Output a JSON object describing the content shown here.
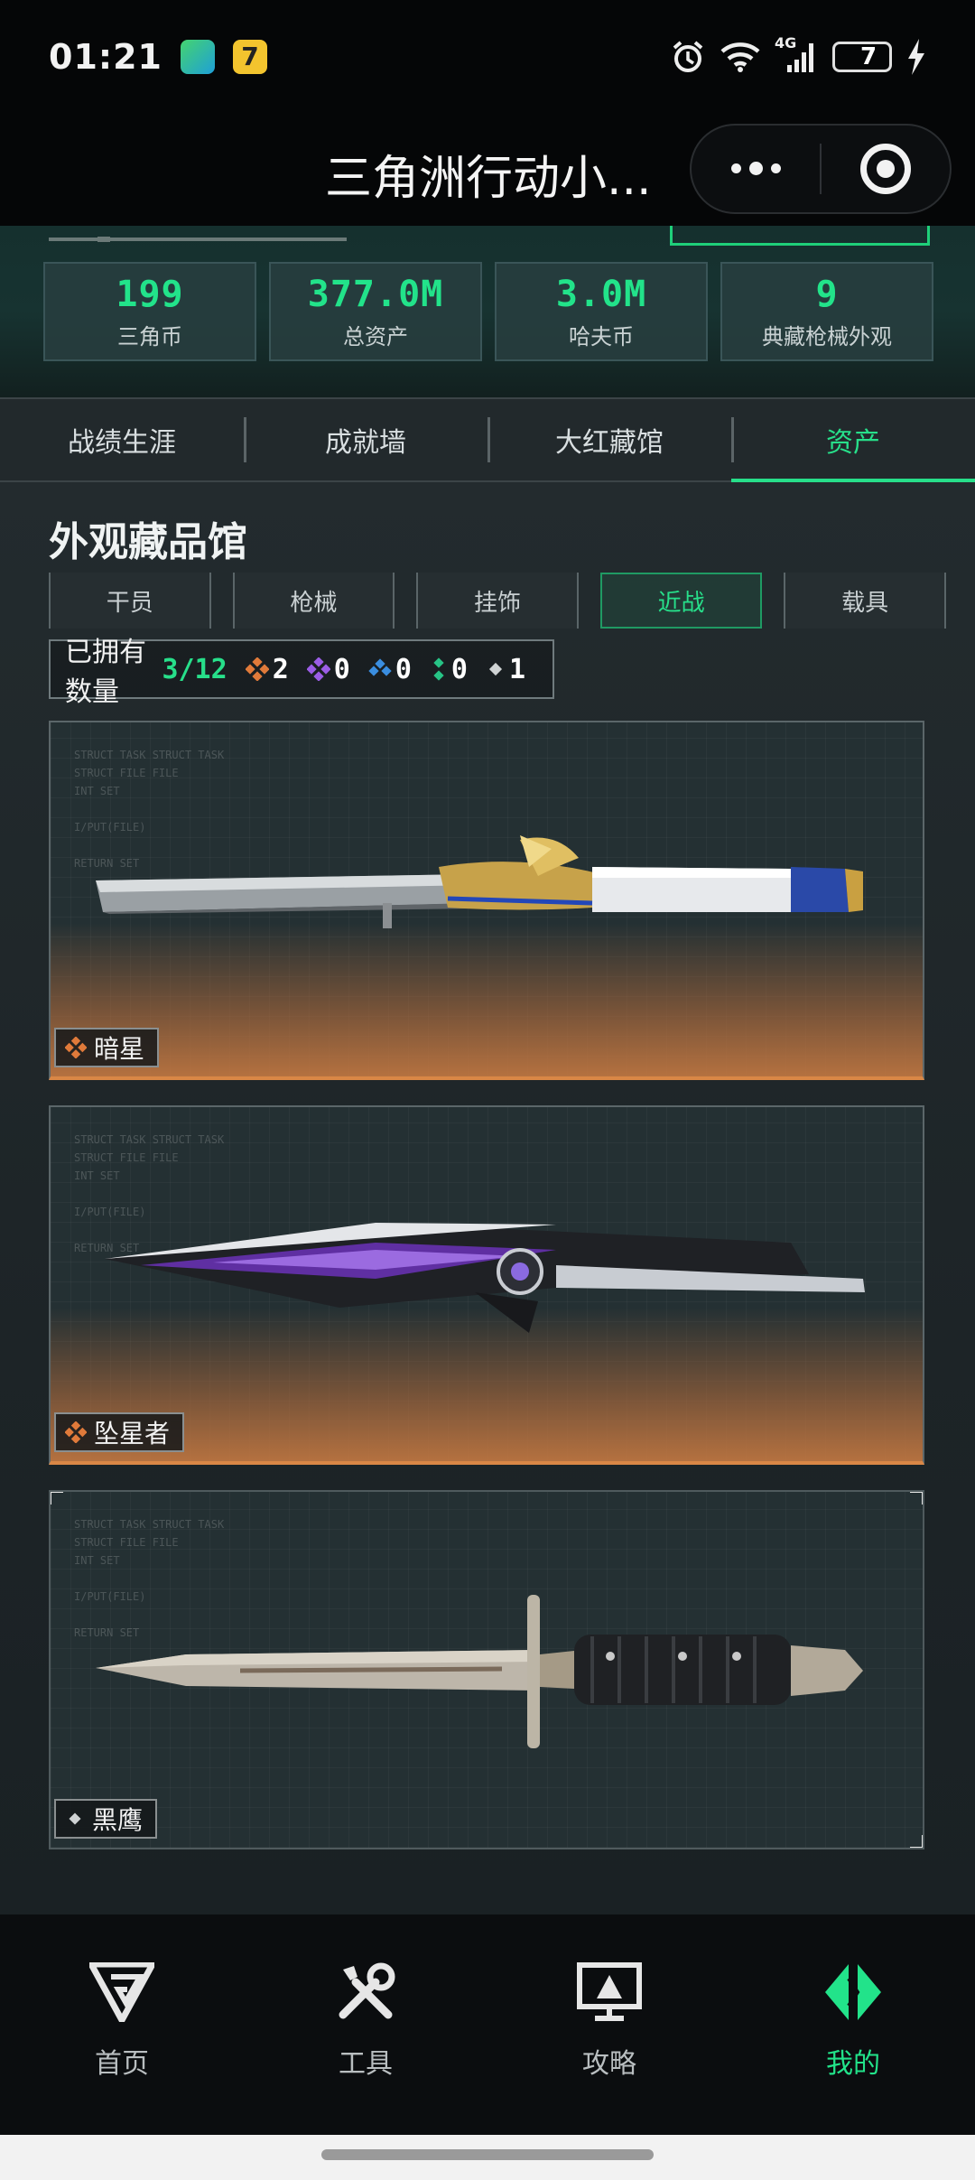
{
  "status_bar": {
    "time": "01:21",
    "app_icon_2_text": "7",
    "network": "4G",
    "battery": "7",
    "icons": [
      "alarm-icon",
      "wifi-icon",
      "signal-icon",
      "battery-icon",
      "charging-icon"
    ]
  },
  "title_bar": {
    "title": "三角洲行动小...",
    "icons": [
      "more-dots-icon",
      "close-target-icon"
    ]
  },
  "stats": [
    {
      "value": "199",
      "label": "三角币"
    },
    {
      "value": "377.0M",
      "label": "总资产"
    },
    {
      "value": "3.0M",
      "label": "哈夫币"
    },
    {
      "value": "9",
      "label": "典藏枪械外观"
    }
  ],
  "main_tabs": [
    {
      "label": "战绩生涯",
      "active": false
    },
    {
      "label": "成就墙",
      "active": false
    },
    {
      "label": "大红藏馆",
      "active": false
    },
    {
      "label": "资产",
      "active": true
    }
  ],
  "collection": {
    "title": "外观藏品馆",
    "sub_tabs": [
      {
        "label": "干员",
        "active": false
      },
      {
        "label": "枪械",
        "active": false
      },
      {
        "label": "挂饰",
        "active": false
      },
      {
        "label": "近战",
        "active": true
      },
      {
        "label": "载具",
        "active": false
      }
    ],
    "owned_label": "已拥有数量",
    "owned_count": "3/12",
    "rarity_counts": [
      {
        "color": "#e07a3a",
        "count": "2"
      },
      {
        "color": "#9b5de5",
        "count": "0"
      },
      {
        "color": "#3a8ee0",
        "count": "0"
      },
      {
        "color": "#27c486",
        "count": "0"
      },
      {
        "color": "#cfd3d4",
        "count": "1"
      }
    ],
    "items": [
      {
        "name": "暗星",
        "rarity_color": "#e07a3a"
      },
      {
        "name": "坠星者",
        "rarity_color": "#e07a3a"
      },
      {
        "name": "黑鹰",
        "rarity_color": "#cfd3d4"
      }
    ]
  },
  "bottom_nav": [
    {
      "label": "首页",
      "icon": "home-logo-icon",
      "active": false
    },
    {
      "label": "工具",
      "icon": "tools-icon",
      "active": false
    },
    {
      "label": "攻略",
      "icon": "guide-monitor-icon",
      "active": false
    },
    {
      "label": "我的",
      "icon": "profile-logo-icon",
      "active": true
    }
  ],
  "colors": {
    "accent": "#27df8a",
    "orange": "#d98746"
  }
}
